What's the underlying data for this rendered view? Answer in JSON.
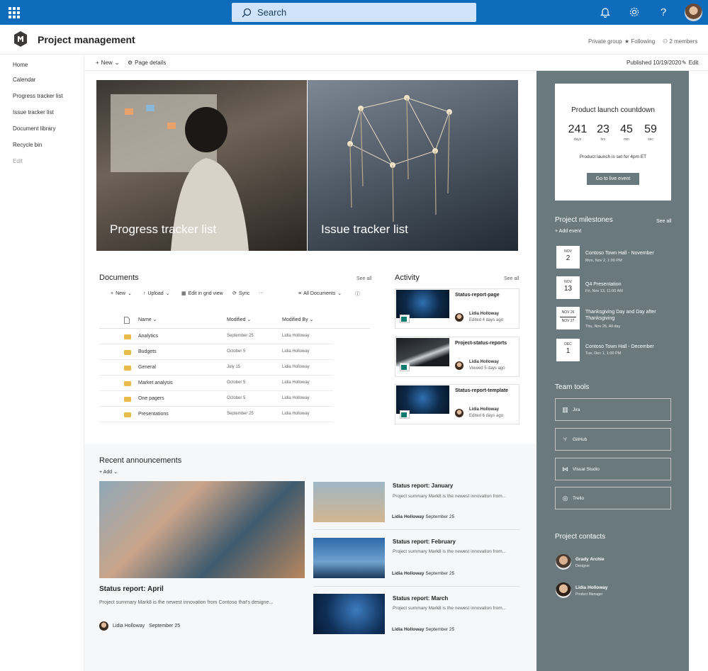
{
  "topbar": {
    "search_placeholder": "Search"
  },
  "site": {
    "title": "Project management",
    "privacy": "Private group",
    "following": "Following",
    "members": "2 members"
  },
  "nav": {
    "items": [
      "Home",
      "Calendar",
      "Progress tracker list",
      "Issue tracker list",
      "Document library",
      "Recycle bin"
    ],
    "edit": "Edit"
  },
  "command": {
    "new": "New",
    "page_details": "Page details",
    "published": "Published 10/19/2020",
    "edit": "Edit"
  },
  "hero": {
    "tile1": "Progress tracker list",
    "tile2": "Issue tracker list"
  },
  "documents": {
    "title": "Documents",
    "see_all": "See all",
    "toolbar": {
      "new": "New",
      "upload": "Upload",
      "edit_grid": "Edit in grid view",
      "sync": "Sync",
      "more": "···",
      "view": "All Documents"
    },
    "columns": {
      "name": "Name",
      "modified": "Modified",
      "modified_by": "Modified By"
    },
    "rows": [
      {
        "name": "Analytics",
        "modified": "September 25",
        "by": "Lidia Holloway"
      },
      {
        "name": "Budgets",
        "modified": "October 5",
        "by": "Lidia Holloway"
      },
      {
        "name": "General",
        "modified": "July 15",
        "by": "Lidia Holloway"
      },
      {
        "name": "Market analysis",
        "modified": "October 5",
        "by": "Lidia Holloway"
      },
      {
        "name": "One pagers",
        "modified": "October 5",
        "by": "Lidia Holloway"
      },
      {
        "name": "Presentations",
        "modified": "September 25",
        "by": "Lidia Holloway"
      }
    ]
  },
  "activity": {
    "title": "Activity",
    "see_all": "See all",
    "cards": [
      {
        "title": "Status-report-page",
        "name": "Lidia Holloway",
        "sub": "Edited 4 days ago"
      },
      {
        "title": "Project-status-reports",
        "name": "Lidia Holloway",
        "sub": "Viewed 5 days ago"
      },
      {
        "title": "Status-report-template",
        "name": "Lidia Holloway",
        "sub": "Edited 6 days ago"
      }
    ]
  },
  "announcements": {
    "title": "Recent announcements",
    "add": "Add",
    "main": {
      "title": "Status report: April",
      "desc": "Project summary Mark8 is the newest innovation from Contoso that's designe...",
      "author": "Lidia Holloway",
      "date": "September 25"
    },
    "items": [
      {
        "title": "Status report: January",
        "desc": "Project summary Mark8 is the newest innovation from...",
        "author": "Lidia Holloway",
        "date": "September 25"
      },
      {
        "title": "Status report: February",
        "desc": "Project summary Mark8 is the newest innovation from...",
        "author": "Lidia Holloway",
        "date": "September 25"
      },
      {
        "title": "Status report: March",
        "desc": "Project summary Mark8 is the newest innovation from...",
        "author": "Lidia Holloway",
        "date": "September 25"
      }
    ]
  },
  "countdown": {
    "title": "Product launch countdown",
    "days": "241",
    "hrs": "23",
    "min": "45",
    "sec": "59",
    "days_l": "days",
    "hrs_l": "hrs",
    "min_l": "min",
    "sec_l": "sec",
    "note": "Product launch is set for 4pm ET",
    "button": "Go to live event"
  },
  "milestones": {
    "title": "Project milestones",
    "see_all": "See all",
    "add": "Add event",
    "items": [
      {
        "month": "NOV",
        "day": "2",
        "title": "Contoso Town Hall - November",
        "sub": "Mon, Nov 2, 1:00 PM"
      },
      {
        "month": "NOV",
        "day": "13",
        "title": "Q4 Presentation",
        "sub": "Fri, Nov 13, 11:00 AM"
      },
      {
        "month": "NOV 26",
        "day": "NOV 27",
        "title": "Thanksgiving Day and Day after Thanksgiving",
        "sub": "Thu, Nov 26, All day"
      },
      {
        "month": "DEC",
        "day": "1",
        "title": "Contoso Town Hall - December",
        "sub": "Tue, Dec 1, 1:00 PM"
      }
    ]
  },
  "tools": {
    "title": "Team tools",
    "items": [
      "Jira",
      "GitHub",
      "Visual Studio",
      "Trello"
    ]
  },
  "contacts": {
    "title": "Project contacts",
    "items": [
      {
        "name": "Grady Archie",
        "role": "Designer"
      },
      {
        "name": "Lidia Holloway",
        "role": "Product Manager"
      }
    ]
  },
  "colors": {
    "suite_bar": "#0f6cbd",
    "search_box": "#cfe4fa",
    "right_rail": "#69797e"
  }
}
